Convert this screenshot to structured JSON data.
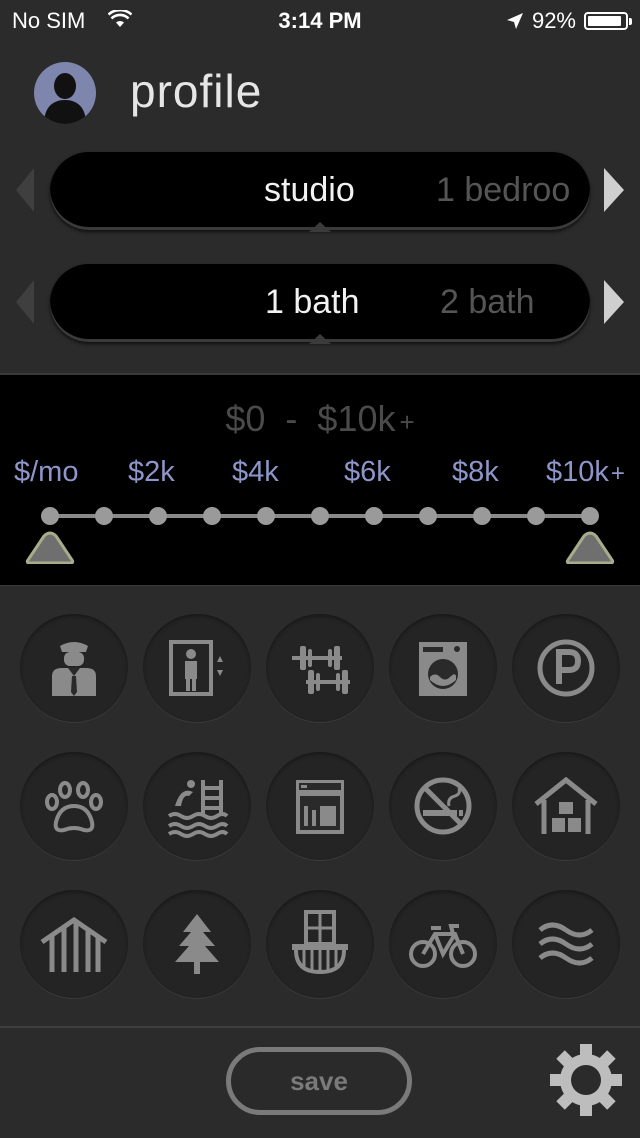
{
  "status_bar": {
    "carrier": "No SIM",
    "time": "3:14 PM",
    "battery_percent": "92%",
    "battery_level": 0.92
  },
  "header": {
    "title": "profile"
  },
  "bedroom_picker": {
    "selected": "studio",
    "next": "1 bedroo"
  },
  "bath_picker": {
    "selected": "1 bath",
    "next": "2 bath"
  },
  "price": {
    "min": "$0",
    "separator": "-",
    "max": "$10k",
    "plus": "+",
    "tick_labels": [
      "$/mo",
      "$2k",
      "$4k",
      "$6k",
      "$8k",
      "$10k"
    ],
    "tick_plus": "+",
    "range_min_fraction": 0.0,
    "range_max_fraction": 1.0
  },
  "amenities": [
    "doorman-icon",
    "elevator-icon",
    "gym-icon",
    "laundry-icon",
    "parking-icon",
    "pets-icon",
    "pool-icon",
    "dishwasher-icon",
    "no-smoking-icon",
    "storage-icon",
    "outdoor-space-icon",
    "park-icon",
    "balcony-icon",
    "bike-storage-icon",
    "waterfront-icon"
  ],
  "bottom_bar": {
    "save_label": "save"
  },
  "colors": {
    "accent": "#8e95c8",
    "avatar": "#7e86ad",
    "thumb": "#8a8f70"
  }
}
